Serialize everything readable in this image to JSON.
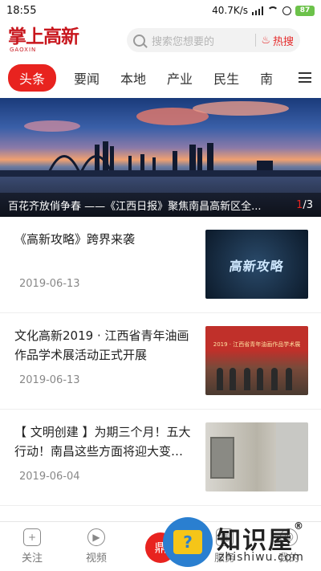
{
  "status_bar": {
    "time": "18:55",
    "network_speed": "40.7K/s",
    "battery": "87",
    "icons": [
      "signal-icon",
      "wifi-icon",
      "alarm-icon",
      "battery-icon"
    ]
  },
  "header": {
    "logo_text": "掌上高新",
    "logo_sub": "GAOXIN",
    "search_placeholder": "搜索您想要的",
    "hot_search_label": "热搜"
  },
  "tabs": [
    {
      "label": "头条",
      "active": true
    },
    {
      "label": "要闻",
      "active": false
    },
    {
      "label": "本地",
      "active": false
    },
    {
      "label": "产业",
      "active": false
    },
    {
      "label": "民生",
      "active": false
    },
    {
      "label": "南",
      "active": false
    }
  ],
  "banner": {
    "caption": "百花齐放俏争春 ——《江西日报》聚焦南昌高新区全...",
    "current": "1",
    "total": "/3"
  },
  "news": [
    {
      "title": "《高新攻略》跨界来袭",
      "date": "2019-06-13",
      "thumb_text": "高新攻略"
    },
    {
      "title": "文化高新2019 · 江西省青年油画作品学术展活动正式开展",
      "date": "2019-06-13",
      "thumb_text": "2019 · 江西省青年油画作品学术展"
    },
    {
      "title": "【 文明创建 】为期三个月！五大行动！南昌这些方面将迎大变…",
      "date": "2019-06-04",
      "thumb_text": ""
    }
  ],
  "bottom_nav": [
    {
      "label": "关注",
      "icon": "follow-icon"
    },
    {
      "label": "视频",
      "icon": "play-icon"
    },
    {
      "label": "鼎",
      "icon": "center-icon"
    },
    {
      "label": "服务",
      "icon": "service-icon"
    },
    {
      "label": "我的",
      "icon": "profile-icon"
    }
  ],
  "watermark": {
    "text": "知识屋",
    "url": "zhishiwu.com"
  },
  "colors": {
    "accent": "#e8231f",
    "logo": "#c8161d"
  }
}
